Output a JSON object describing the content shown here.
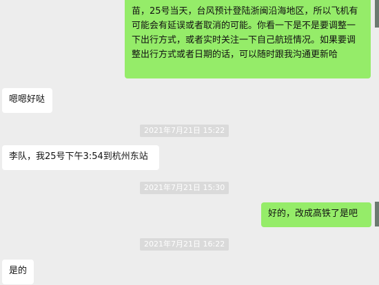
{
  "conversation": {
    "messages": [
      {
        "side": "out",
        "text": "苗，25号当天，台风预计登陆浙闽沿海地区，所以飞机有可能会有延误或者取消的可能。你看一下是不是要调整一下出行方式，或者实时关注一下自己航班情况。如果要调整出行方式或者日期的话，可以随时跟我沟通更新哈"
      },
      {
        "side": "in",
        "text": "嗯嗯好哒"
      },
      {
        "side": "time",
        "text": "2021年7月21日  15:22"
      },
      {
        "side": "in",
        "text": "李队，我25号下午3:54到杭州东站"
      },
      {
        "side": "time",
        "text": "2021年7月21日  15:30"
      },
      {
        "side": "out",
        "text": "好的，改成高铁了是吧"
      },
      {
        "side": "time",
        "text": "2021年7月21日  16:22"
      },
      {
        "side": "in",
        "text": "是的"
      }
    ]
  },
  "colors": {
    "background": "#ededed",
    "outgoing_bubble": "#95ec69",
    "incoming_bubble": "#ffffff",
    "timestamp_badge": "#dadada"
  }
}
